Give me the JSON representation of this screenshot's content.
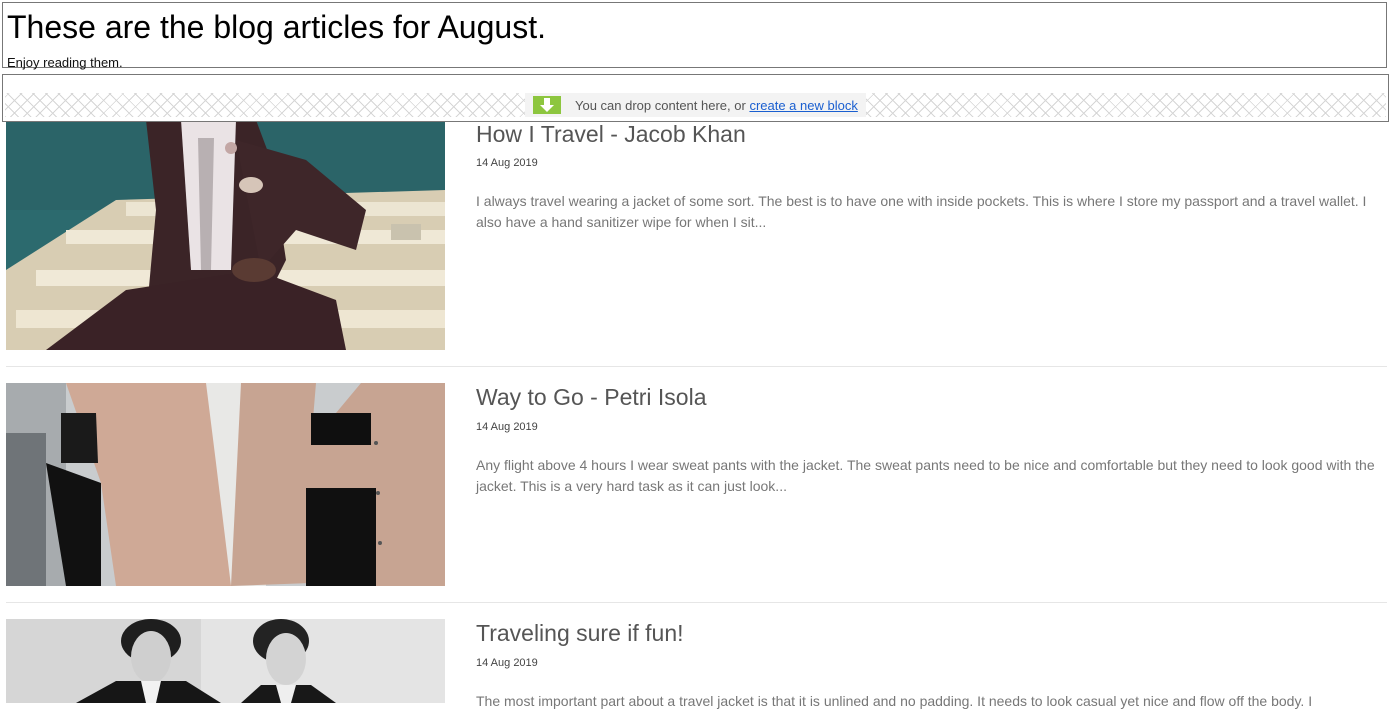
{
  "header": {
    "title": "These are the blog articles for August.",
    "subtitle": "Enjoy reading them."
  },
  "drop_zone": {
    "text": "You can drop content here, or",
    "link": "create a new block",
    "icon": "download-arrow-icon"
  },
  "articles": [
    {
      "title": "How I Travel - Jacob Khan",
      "date": "14 Aug 2019",
      "excerpt": "I always travel wearing a jacket of some sort. The best is to have one with inside pockets. This is where I store my passport and a travel wallet. I also have a hand sanitizer wipe for when I sit..."
    },
    {
      "title": "Way to Go - Petri Isola",
      "date": "14 Aug 2019",
      "excerpt": "Any flight above 4 hours I wear sweat pants with the jacket. The sweat pants need to be nice and comfortable but they need to look good with the jacket. This is a very hard task as it can just look..."
    },
    {
      "title": "Traveling sure if fun!",
      "date": "14 Aug 2019",
      "excerpt": "The most important part about a travel jacket is that it is unlined and no padding. It needs to look casual yet nice and flow off the body. I"
    }
  ],
  "colors": {
    "drop_icon": "#8dc63f",
    "link": "#1a5fd0",
    "title_text": "#555555",
    "excerpt_text": "#777777"
  }
}
